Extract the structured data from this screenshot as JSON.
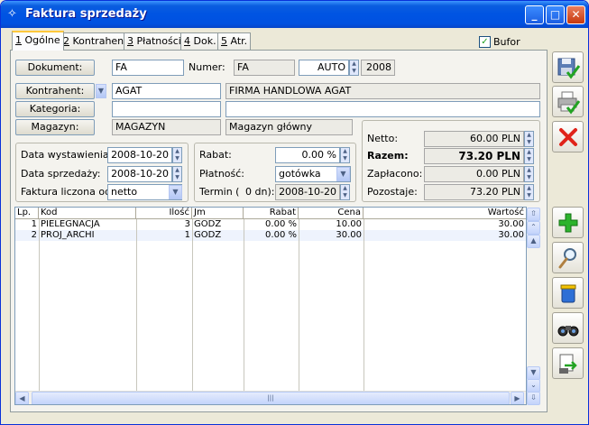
{
  "window": {
    "title": "Faktura sprzedaży"
  },
  "tabs": [
    {
      "num": "1",
      "label": " Ogólne"
    },
    {
      "num": "2",
      "label": " Kontrahent"
    },
    {
      "num": "3",
      "label": " Płatności"
    },
    {
      "num": "4",
      "label": " Dok."
    },
    {
      "num": "5",
      "label": " Atr."
    }
  ],
  "bufor": {
    "label": "Bufor",
    "checked": true
  },
  "header": {
    "dokument_btn": "Dokument:",
    "dokument_value": "FA",
    "numer_label": "Numer:",
    "numer_prefix": "FA",
    "numer_auto": "AUTO",
    "numer_year": "2008",
    "kontrahent_btn": "Kontrahent:",
    "kontrahent_code": "AGAT",
    "kontrahent_name": "FIRMA HANDLOWA AGAT",
    "kategoria_btn": "Kategoria:",
    "kategoria_value": "",
    "kategoria_desc": "",
    "magazyn_btn": "Magazyn:",
    "magazyn_code": "MAGAZYN",
    "magazyn_name": "Magazyn główny"
  },
  "dates": {
    "wystawienia_label": "Data wystawienia:",
    "wystawienia_value": "2008-10-20",
    "sprzedazy_label": "Data sprzedaży:",
    "sprzedazy_value": "2008-10-20",
    "liczona_label": "Faktura liczona od:",
    "liczona_value": "netto"
  },
  "payment": {
    "rabat_label": "Rabat:",
    "rabat_value": "0.00 %",
    "platnosc_label": "Płatność:",
    "platnosc_value": "gotówka",
    "termin_label": "Termin (",
    "termin_days": "0 dn):",
    "termin_value": "2008-10-20"
  },
  "totals": {
    "netto_label": "Netto:",
    "netto_value": "60.00 PLN",
    "razem_label": "Razem:",
    "razem_value": "73.20 PLN",
    "zaplacono_label": "Zapłacono:",
    "zaplacono_value": "0.00 PLN",
    "pozostaje_label": "Pozostaje:",
    "pozostaje_value": "73.20 PLN"
  },
  "table": {
    "columns": [
      "Lp.",
      "Kod",
      "Ilość",
      "Jm",
      "Rabat",
      "Cena",
      "Wartość"
    ],
    "rows": [
      {
        "lp": "1",
        "kod": "PIELEGNACJA",
        "ilosc": "3",
        "jm": "GODZ",
        "rabat": "0.00 %",
        "cena": "10.00",
        "wartosc": "30.00"
      },
      {
        "lp": "2",
        "kod": "PROJ_ARCHI",
        "ilosc": "1",
        "jm": "GODZ",
        "rabat": "0.00 %",
        "cena": "30.00",
        "wartosc": "30.00"
      }
    ]
  },
  "colors": {
    "titlebar": "#0054e3",
    "delete": "#e0231a",
    "add": "#22a322"
  },
  "icons": {
    "save": "floppy-check-icon",
    "print": "printer-check-icon",
    "cancel": "red-x-icon",
    "add": "green-plus-icon",
    "view": "magnifier-icon",
    "delete": "trash-bin-icon",
    "search": "binoculars-icon",
    "import": "document-arrow-icon"
  }
}
